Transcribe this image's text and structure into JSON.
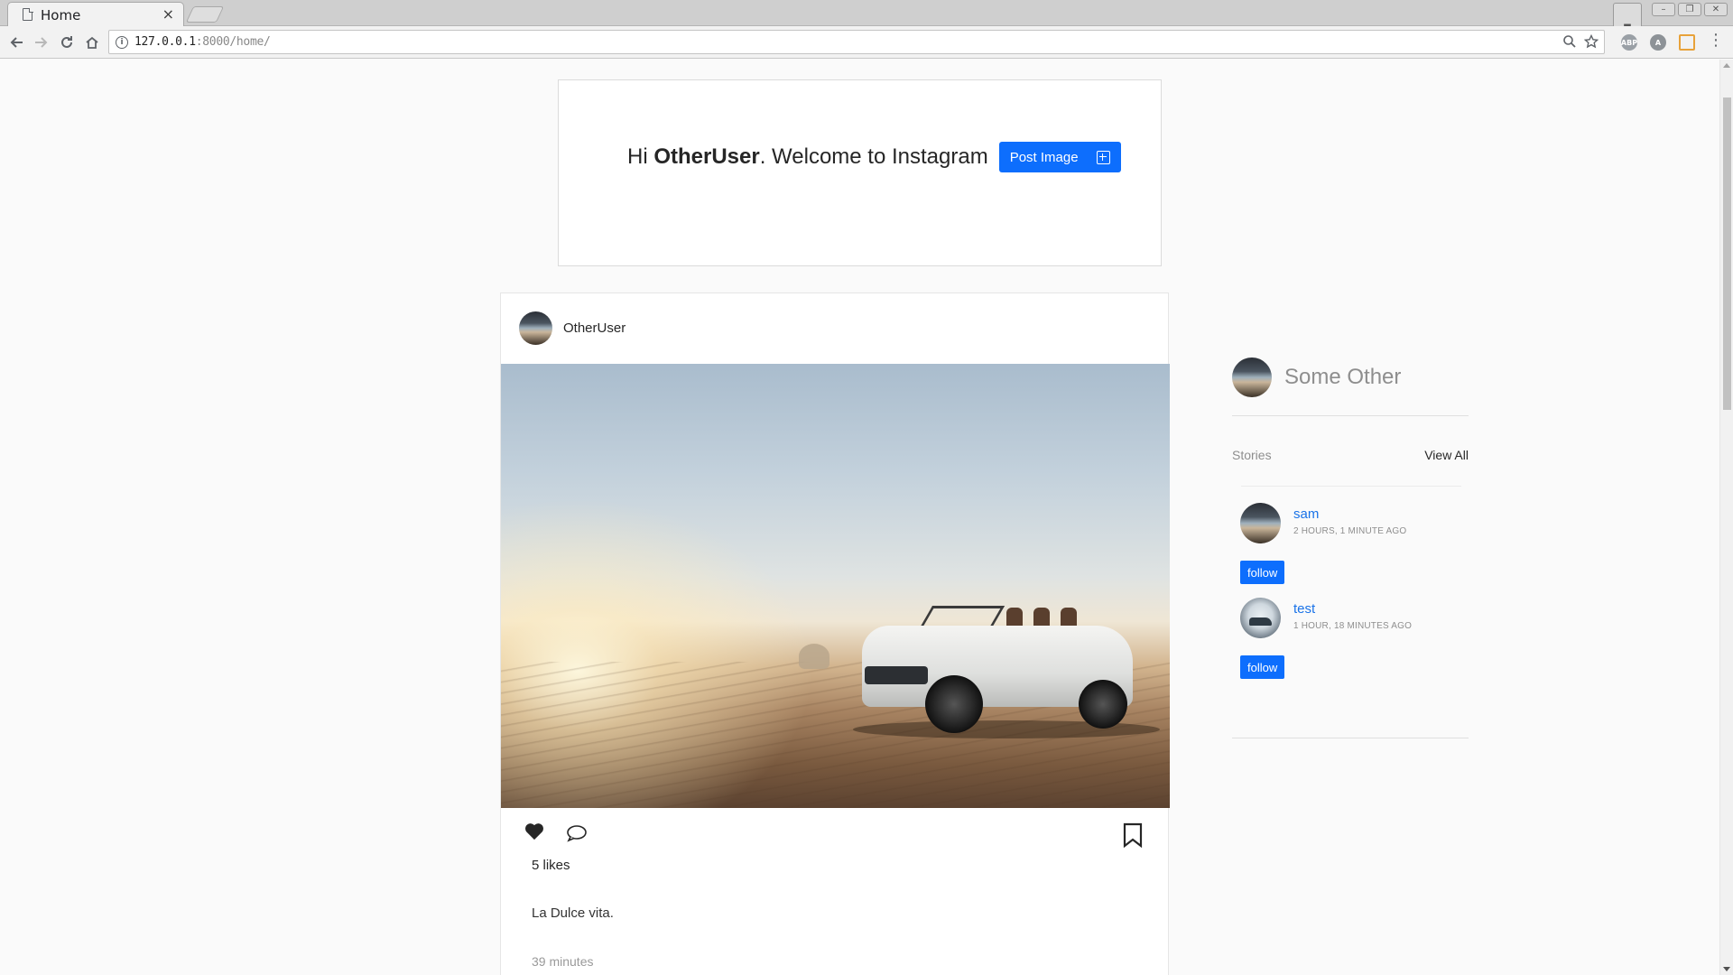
{
  "browser": {
    "tab_title": "Home",
    "tab_close": "×",
    "url_host": "127.0.0.1",
    "url_rest": ":8000/home/",
    "icons": {
      "back": "back-arrow-icon",
      "forward": "forward-arrow-icon",
      "reload": "reload-icon",
      "home": "home-icon",
      "info": "info-icon",
      "zoom": "magnifier-icon",
      "star": "star-icon",
      "menu": "menu-dots-icon"
    }
  },
  "welcome": {
    "greeting": "Hi",
    "username": "OtherUser",
    "message": ". Welcome to Instagram",
    "post_button": "Post Image"
  },
  "post": {
    "username": "OtherUser",
    "likes": "5 likes",
    "caption": "La Dulce vita.",
    "time": "39 minutes"
  },
  "sidebar": {
    "profile_name": "Some Other",
    "stories_label": "Stories",
    "view_all": "View All",
    "stories": [
      {
        "name": "sam",
        "time": "2 hours, 1 minute ago",
        "follow": "follow"
      },
      {
        "name": "test",
        "time": "1 hour, 18 minutes ago",
        "follow": "follow"
      }
    ]
  },
  "colors": {
    "accent": "#0d6efd",
    "link": "#1a73e8",
    "page_bg": "#fafafa"
  }
}
